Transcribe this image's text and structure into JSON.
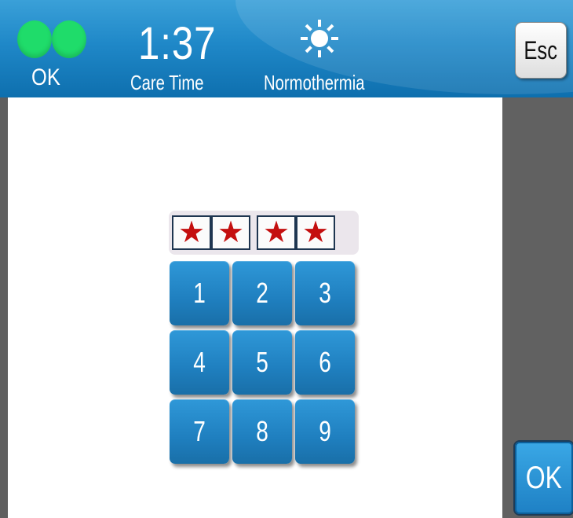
{
  "header": {
    "status": "OK",
    "care_time_value": "1:37",
    "care_time_label": "Care Time",
    "mode_label": "Normothermia",
    "mode_icon": "sun-icon",
    "esc_label": "Esc",
    "status_color": "#1fdc6a"
  },
  "pin": {
    "masked": [
      "★",
      "★",
      "★",
      "★"
    ],
    "mask_color": "#c40f0f"
  },
  "keypad": {
    "keys": [
      "1",
      "2",
      "3",
      "4",
      "5",
      "6",
      "7",
      "8",
      "9"
    ]
  },
  "footer": {
    "ok_label": "OK"
  },
  "colors": {
    "accent": "#1f80c4",
    "panel": "#ffffff",
    "sidebar": "#616161"
  }
}
